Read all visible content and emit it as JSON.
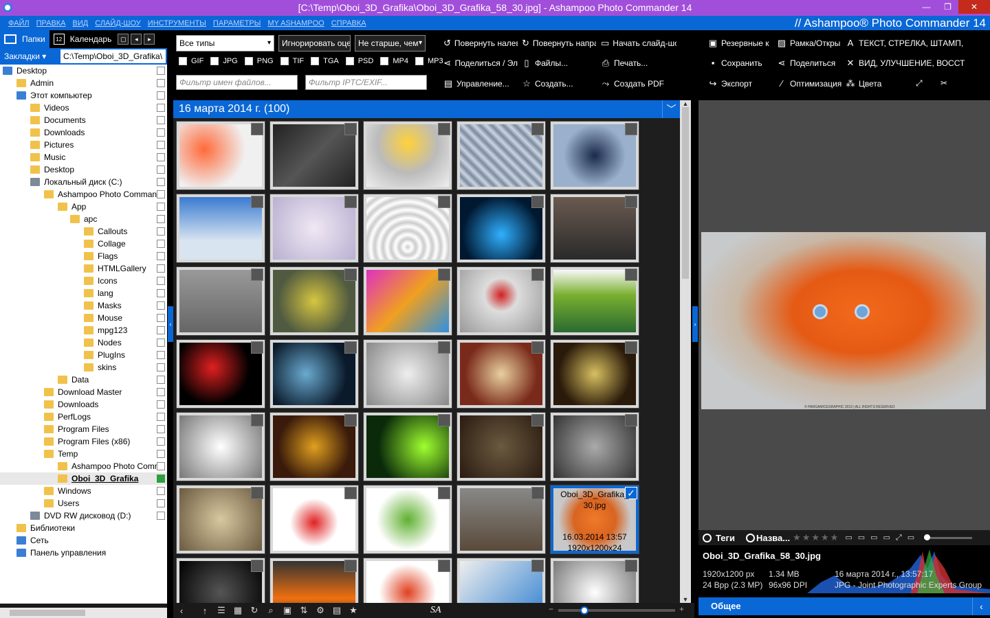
{
  "window": {
    "title": "[C:\\Temp\\Oboi_3D_Grafika\\Oboi_3D_Grafika_58_30.jpg] - Ashampoo Photo Commander 14",
    "minimize": "—",
    "maximize": "❐",
    "close": "✕"
  },
  "menu": {
    "items": [
      "ФАЙЛ",
      "ПРАВКА",
      "ВИД",
      "СЛАЙД-ШОУ",
      "ИНСТРУМЕНТЫ",
      "ПАРАМЕТРЫ",
      "MY ASHAMPOO",
      "СПРАВКА"
    ],
    "brand": "// Ashampoo® Photo Commander 14"
  },
  "left": {
    "tab_folders": "Папки",
    "tab_calendar": "Календарь",
    "calendar_day": "12",
    "bookmarks": "Закладки ▾",
    "path": "C:\\Temp\\Oboi_3D_Grafika\\",
    "tree": [
      {
        "label": "Desktop",
        "kind": "pc"
      },
      {
        "label": "Admin",
        "kind": "folder"
      },
      {
        "label": "Этот компьютер",
        "kind": "pc"
      },
      {
        "label": "Videos",
        "kind": "folder"
      },
      {
        "label": "Documents",
        "kind": "folder"
      },
      {
        "label": "Downloads",
        "kind": "folder"
      },
      {
        "label": "Pictures",
        "kind": "folder"
      },
      {
        "label": "Music",
        "kind": "folder"
      },
      {
        "label": "Desktop",
        "kind": "folder"
      },
      {
        "label": "Локальный диск (C:)",
        "kind": "disk"
      },
      {
        "label": "Ashampoo Photo Comman",
        "kind": "folder"
      },
      {
        "label": "App",
        "kind": "folder"
      },
      {
        "label": "apc",
        "kind": "folder"
      },
      {
        "label": "Callouts",
        "kind": "folder"
      },
      {
        "label": "Collage",
        "kind": "folder"
      },
      {
        "label": "Flags",
        "kind": "folder"
      },
      {
        "label": "HTMLGallery",
        "kind": "folder"
      },
      {
        "label": "Icons",
        "kind": "folder"
      },
      {
        "label": "lang",
        "kind": "folder"
      },
      {
        "label": "Masks",
        "kind": "folder"
      },
      {
        "label": "Mouse",
        "kind": "folder"
      },
      {
        "label": "mpg123",
        "kind": "folder"
      },
      {
        "label": "Nodes",
        "kind": "folder"
      },
      {
        "label": "PlugIns",
        "kind": "folder"
      },
      {
        "label": "skins",
        "kind": "folder"
      },
      {
        "label": "Data",
        "kind": "folder"
      },
      {
        "label": "Download Master",
        "kind": "folder"
      },
      {
        "label": "Downloads",
        "kind": "folder"
      },
      {
        "label": "PerfLogs",
        "kind": "folder"
      },
      {
        "label": "Program Files",
        "kind": "folder"
      },
      {
        "label": "Program Files (x86)",
        "kind": "folder"
      },
      {
        "label": "Temp",
        "kind": "folder"
      },
      {
        "label": "Ashampoo Photo Comm",
        "kind": "folder"
      },
      {
        "label": "Oboi_3D_Grafika",
        "kind": "folder"
      },
      {
        "label": "Windows",
        "kind": "folder"
      },
      {
        "label": "Users",
        "kind": "folder"
      },
      {
        "label": "DVD RW дисковод (D:)",
        "kind": "disk"
      },
      {
        "label": "Библиотеки",
        "kind": "folder"
      },
      {
        "label": "Сеть",
        "kind": "pc"
      },
      {
        "label": "Панель управления",
        "kind": "pc"
      }
    ]
  },
  "toolbar": {
    "type_select": "Все типы",
    "rating_select": "Игнорировать оцен",
    "age_select": "Не старше, чем",
    "filetypes": [
      "GIF",
      "JPG",
      "PNG",
      "TIF",
      "TGA",
      "PSD",
      "MP4",
      "MP3"
    ],
    "filter_names_placeholder": "Фильтр имен файлов...",
    "filter_iptc_placeholder": "Фильтр IPTC/EXIF...",
    "rotate_left": "Повернуть налев",
    "rotate_right": "Повернуть напра",
    "slideshow": "Начать слайд-шо",
    "share": "Поделиться / Эл",
    "files": "Файлы...",
    "print": "Печать...",
    "manage": "Управление...",
    "create": "Создать...",
    "create_pdf": "Создать PDF"
  },
  "right_toolbar": {
    "backup": "Резервные к",
    "frame": "Рамка/Откры",
    "text": "ТЕКСТ, СТРЕЛКА, ШТАМП,",
    "save": "Сохранить",
    "share": "Поделиться",
    "view": "ВИД, УЛУЧШЕНИЕ, ВОССТ",
    "export": "Экспорт",
    "optimize": "Оптимизация",
    "colors": "Цвета"
  },
  "group": {
    "header": "16 марта 2014 г. (100)"
  },
  "selected_thumb": {
    "name1": "Oboi_3D_Grafika_",
    "name2": "30.jpg",
    "date": "16.03.2014 13:57",
    "dims": "1920x1200x24"
  },
  "preview": {
    "copyright": "© PARGAMICEGRAPHIC 2013 | ALL RIGHTS RESERVED"
  },
  "status": {
    "tags": "Теги",
    "name": "Назва...",
    "stars": "★★★★★"
  },
  "info": {
    "filename": "Oboi_3D_Grafika_58_30.jpg",
    "resolution": "1920x1200 px",
    "size": "1.34 MB",
    "bpp": "24 Bpp (2.3 MP)",
    "dpi": "96x96 DPI",
    "date": "16 марта 2014 г., 13:57:17",
    "format": "JPG - Joint Photographic Experts Group"
  },
  "footer": {
    "general": "Общее"
  },
  "bottom": {
    "sa": "SA",
    "zoom_minus": "−",
    "zoom_plus": "+"
  }
}
